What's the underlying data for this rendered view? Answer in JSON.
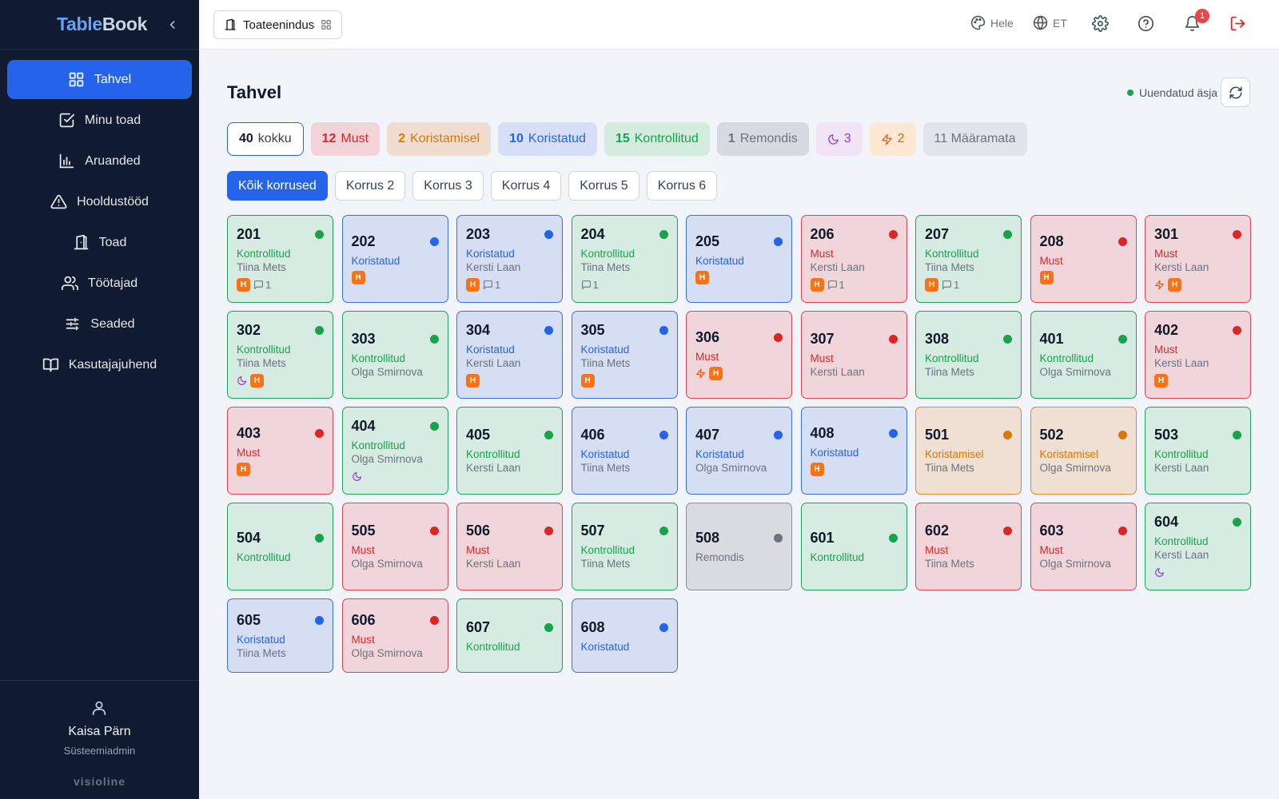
{
  "brand": {
    "part1": "Table",
    "part2": "Book"
  },
  "sidebar": {
    "items": [
      {
        "label": "Tahvel",
        "icon": "grid-icon"
      },
      {
        "label": "Minu toad",
        "icon": "check-square-icon"
      },
      {
        "label": "Aruanded",
        "icon": "bar-chart-icon"
      },
      {
        "label": "Hooldustööd",
        "icon": "warning-icon"
      },
      {
        "label": "Toad",
        "icon": "door-icon"
      },
      {
        "label": "Töötajad",
        "icon": "users-icon"
      },
      {
        "label": "Seaded",
        "icon": "sliders-icon"
      },
      {
        "label": "Kasutajajuhend",
        "icon": "book-icon"
      }
    ],
    "user": {
      "name": "Kaisa Pärn",
      "role": "Süsteemiadmin"
    },
    "vendor": "visioline"
  },
  "topbar": {
    "department": "Toateenindus",
    "theme": "Hele",
    "language": "ET",
    "notifications": "1"
  },
  "main": {
    "title": "Tahvel",
    "updated": "Uuendatud äsja",
    "stats": {
      "total": {
        "count": "40",
        "label": "kokku"
      },
      "dirty": {
        "count": "12",
        "label": "Must"
      },
      "cleaning": {
        "count": "2",
        "label": "Koristamisel"
      },
      "cleaned": {
        "count": "10",
        "label": "Koristatud"
      },
      "checked": {
        "count": "15",
        "label": "Kontrollitud"
      },
      "repair": {
        "count": "1",
        "label": "Remondis"
      },
      "night": {
        "count": "3"
      },
      "urgent": {
        "count": "2"
      },
      "unassigned": "11 Määramata"
    },
    "floors": [
      "Kõik korrused",
      "Korrus 2",
      "Korrus 3",
      "Korrus 4",
      "Korrus 5",
      "Korrus 6"
    ],
    "rooms": [
      {
        "num": "201",
        "status": "Kontrollitud",
        "color": "green",
        "person": "Tiina Mets",
        "h": true,
        "comments": "1"
      },
      {
        "num": "202",
        "status": "Koristatud",
        "color": "blue",
        "person": "",
        "h": true
      },
      {
        "num": "203",
        "status": "Koristatud",
        "color": "blue",
        "person": "Kersti Laan",
        "h": true,
        "comments": "1"
      },
      {
        "num": "204",
        "status": "Kontrollitud",
        "color": "green",
        "person": "Tiina Mets",
        "comments": "1"
      },
      {
        "num": "205",
        "status": "Koristatud",
        "color": "blue",
        "person": "",
        "h": true
      },
      {
        "num": "206",
        "status": "Must",
        "color": "red",
        "person": "Kersti Laan",
        "h": true,
        "comments": "1"
      },
      {
        "num": "207",
        "status": "Kontrollitud",
        "color": "green",
        "person": "Tiina Mets",
        "h": true,
        "comments": "1"
      },
      {
        "num": "208",
        "status": "Must",
        "color": "red",
        "person": "",
        "h": true
      },
      {
        "num": "301",
        "status": "Must",
        "color": "red",
        "person": "Kersti Laan",
        "urgent": true,
        "h": true
      },
      {
        "num": "302",
        "status": "Kontrollitud",
        "color": "green",
        "person": "Tiina Mets",
        "night": true,
        "h": true
      },
      {
        "num": "303",
        "status": "Kontrollitud",
        "color": "green",
        "person": "Olga Smirnova"
      },
      {
        "num": "304",
        "status": "Koristatud",
        "color": "blue",
        "person": "Kersti Laan",
        "h": true
      },
      {
        "num": "305",
        "status": "Koristatud",
        "color": "blue",
        "person": "Tiina Mets",
        "h": true
      },
      {
        "num": "306",
        "status": "Must",
        "color": "red",
        "person": "",
        "urgent": true,
        "h": true
      },
      {
        "num": "307",
        "status": "Must",
        "color": "red",
        "person": "Kersti Laan"
      },
      {
        "num": "308",
        "status": "Kontrollitud",
        "color": "green",
        "person": "Tiina Mets"
      },
      {
        "num": "401",
        "status": "Kontrollitud",
        "color": "green",
        "person": "Olga Smirnova"
      },
      {
        "num": "402",
        "status": "Must",
        "color": "red",
        "person": "Kersti Laan",
        "h": true
      },
      {
        "num": "403",
        "status": "Must",
        "color": "red",
        "person": "",
        "h": true
      },
      {
        "num": "404",
        "status": "Kontrollitud",
        "color": "green",
        "person": "Olga Smirnova",
        "night": true
      },
      {
        "num": "405",
        "status": "Kontrollitud",
        "color": "green",
        "person": "Kersti Laan"
      },
      {
        "num": "406",
        "status": "Koristatud",
        "color": "blue",
        "person": "Tiina Mets"
      },
      {
        "num": "407",
        "status": "Koristatud",
        "color": "blue",
        "person": "Olga Smirnova"
      },
      {
        "num": "408",
        "status": "Koristatud",
        "color": "blue",
        "person": "",
        "h": true
      },
      {
        "num": "501",
        "status": "Koristamisel",
        "color": "orange",
        "person": "Tiina Mets"
      },
      {
        "num": "502",
        "status": "Koristamisel",
        "color": "orange",
        "person": "Olga Smirnova"
      },
      {
        "num": "503",
        "status": "Kontrollitud",
        "color": "green",
        "person": "Kersti Laan"
      },
      {
        "num": "504",
        "status": "Kontrollitud",
        "color": "green",
        "person": ""
      },
      {
        "num": "505",
        "status": "Must",
        "color": "red",
        "person": "Olga Smirnova"
      },
      {
        "num": "506",
        "status": "Must",
        "color": "red",
        "person": "Kersti Laan"
      },
      {
        "num": "507",
        "status": "Kontrollitud",
        "color": "green",
        "person": "Tiina Mets"
      },
      {
        "num": "508",
        "status": "Remondis",
        "color": "gray",
        "person": ""
      },
      {
        "num": "601",
        "status": "Kontrollitud",
        "color": "green",
        "person": ""
      },
      {
        "num": "602",
        "status": "Must",
        "color": "red",
        "person": "Tiina Mets"
      },
      {
        "num": "603",
        "status": "Must",
        "color": "red",
        "person": "Olga Smirnova"
      },
      {
        "num": "604",
        "status": "Kontrollitud",
        "color": "green",
        "person": "Kersti Laan",
        "night": true
      },
      {
        "num": "605",
        "status": "Koristatud",
        "color": "blue",
        "person": "Tiina Mets"
      },
      {
        "num": "606",
        "status": "Must",
        "color": "red",
        "person": "Olga Smirnova"
      },
      {
        "num": "607",
        "status": "Kontrollitud",
        "color": "green",
        "person": ""
      },
      {
        "num": "608",
        "status": "Koristatud",
        "color": "blue",
        "person": ""
      }
    ],
    "badge_letter": "H"
  },
  "colors": {
    "accent": "#2563eb",
    "sidebar": "#101a30",
    "green": "#16a34a",
    "red": "#dc2626",
    "orange": "#d97706",
    "gray": "#6b7280"
  }
}
